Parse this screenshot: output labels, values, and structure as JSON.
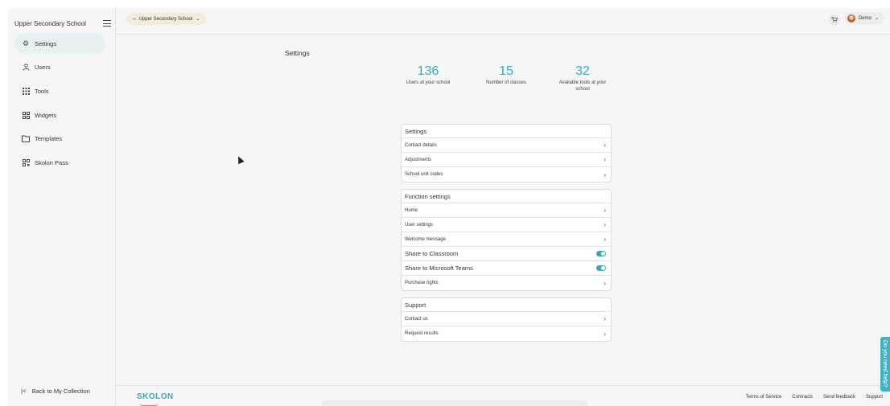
{
  "sidebar": {
    "title": "Upper Secondary School",
    "items": [
      {
        "label": "Settings",
        "icon": "gear-icon",
        "active": true
      },
      {
        "label": "Users",
        "icon": "user-icon",
        "active": false
      },
      {
        "label": "Tools",
        "icon": "grid-icon",
        "active": false
      },
      {
        "label": "Widgets",
        "icon": "widgets-icon",
        "active": false
      },
      {
        "label": "Templates",
        "icon": "folder-icon",
        "active": false
      },
      {
        "label": "Skolon Pass",
        "icon": "pass-icon",
        "active": false
      }
    ],
    "back_label": "Back to My Collection"
  },
  "topbar": {
    "school_selector": "Upper Secondary School",
    "user_name": "Demo"
  },
  "main": {
    "title": "Settings",
    "stats": [
      {
        "value": "136",
        "label": "Users at your school"
      },
      {
        "value": "15",
        "label": "Number of classes"
      },
      {
        "value": "32",
        "label": "Available tools at your school"
      }
    ],
    "cards": [
      {
        "title": "Settings",
        "rows": [
          {
            "label": "Contact details",
            "type": "link"
          },
          {
            "label": "Adjustments",
            "type": "link"
          },
          {
            "label": "School unit codes",
            "type": "link"
          }
        ]
      },
      {
        "title": "Function settings",
        "rows": [
          {
            "label": "Home",
            "type": "link"
          },
          {
            "label": "User settings",
            "type": "link"
          },
          {
            "label": "Welcome message",
            "type": "link"
          },
          {
            "label": "Share to Classroom",
            "type": "toggle",
            "on": true
          },
          {
            "label": "Share to Microsoft Teams",
            "type": "toggle",
            "on": true
          },
          {
            "label": "Purchase rights",
            "type": "link"
          }
        ]
      },
      {
        "title": "Support",
        "rows": [
          {
            "label": "Contact us",
            "type": "link"
          },
          {
            "label": "Request results",
            "type": "link"
          }
        ]
      }
    ]
  },
  "footer": {
    "logo": "SKOLON",
    "links": [
      "Terms of Service",
      "Contracts",
      "Send feedback",
      "Support"
    ]
  },
  "help_tab": "Do you need help?",
  "colors": {
    "accent": "#3aa8b7",
    "active_nav": "#e7f0f3",
    "school_pill": "#f2ecdc"
  }
}
